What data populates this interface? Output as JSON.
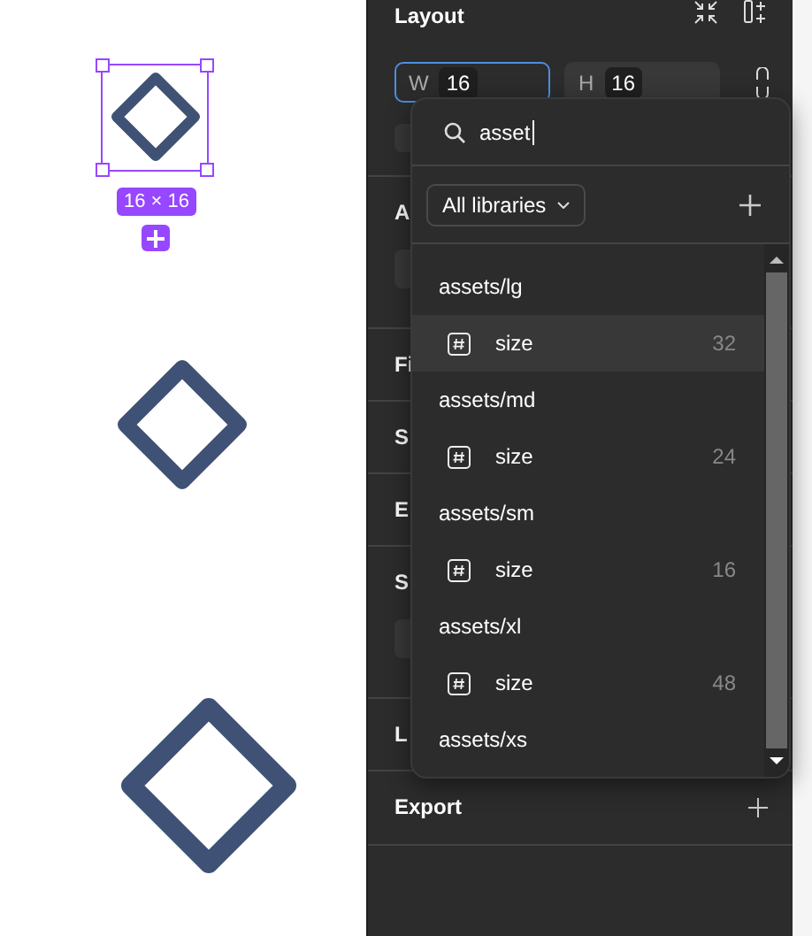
{
  "canvas": {
    "selection_size": "16 × 16"
  },
  "panel": {
    "title": "Layout",
    "fields": [
      {
        "label": "W",
        "value": "16",
        "focused": true
      },
      {
        "label": "H",
        "value": "16",
        "focused": false
      }
    ],
    "sections": [
      {
        "label": "A",
        "control": true
      },
      {
        "label": "Fi",
        "control": false
      },
      {
        "label": "S",
        "control": false
      },
      {
        "label": "E",
        "control": false
      },
      {
        "label": "S",
        "control": true
      },
      {
        "label": "L",
        "control": false
      }
    ],
    "export": "Export"
  },
  "popup": {
    "search": {
      "value": "asset"
    },
    "library_filter": "All libraries",
    "groups": [
      {
        "name": "assets/lg",
        "items": [
          {
            "name": "size",
            "value": "32",
            "selected": true
          }
        ]
      },
      {
        "name": "assets/md",
        "items": [
          {
            "name": "size",
            "value": "24",
            "selected": false
          }
        ]
      },
      {
        "name": "assets/sm",
        "items": [
          {
            "name": "size",
            "value": "16",
            "selected": false
          }
        ]
      },
      {
        "name": "assets/xl",
        "items": [
          {
            "name": "size",
            "value": "48",
            "selected": false
          }
        ]
      },
      {
        "name": "assets/xs"
      }
    ]
  }
}
